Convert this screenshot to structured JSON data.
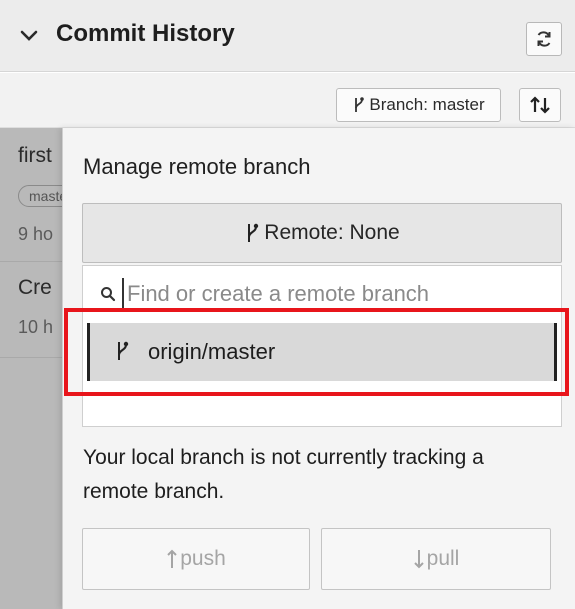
{
  "header": {
    "title": "Commit History",
    "collapse_icon": "chevron-down-icon",
    "refresh_icon": "refresh-icon"
  },
  "toolbar": {
    "branch_button_label": "Branch: master",
    "sort_icon": "sort-arrows-icon"
  },
  "commits": [
    {
      "message": "first",
      "tag": "master",
      "time": "9 ho"
    },
    {
      "message": "Cre",
      "time": "10 h"
    }
  ],
  "popover": {
    "title": "Manage remote branch",
    "remote_button_label": "Remote: None",
    "search_placeholder": "Find or create a remote branch",
    "search_value": "",
    "branches": [
      {
        "label": "origin/master",
        "highlighted": true
      }
    ],
    "tracking_message": "Your local branch is not currently tracking a remote branch.",
    "push_label": "push",
    "pull_label": "pull"
  },
  "colors": {
    "highlight_border": "#e8151b",
    "overlay": "#b9b9b9"
  }
}
